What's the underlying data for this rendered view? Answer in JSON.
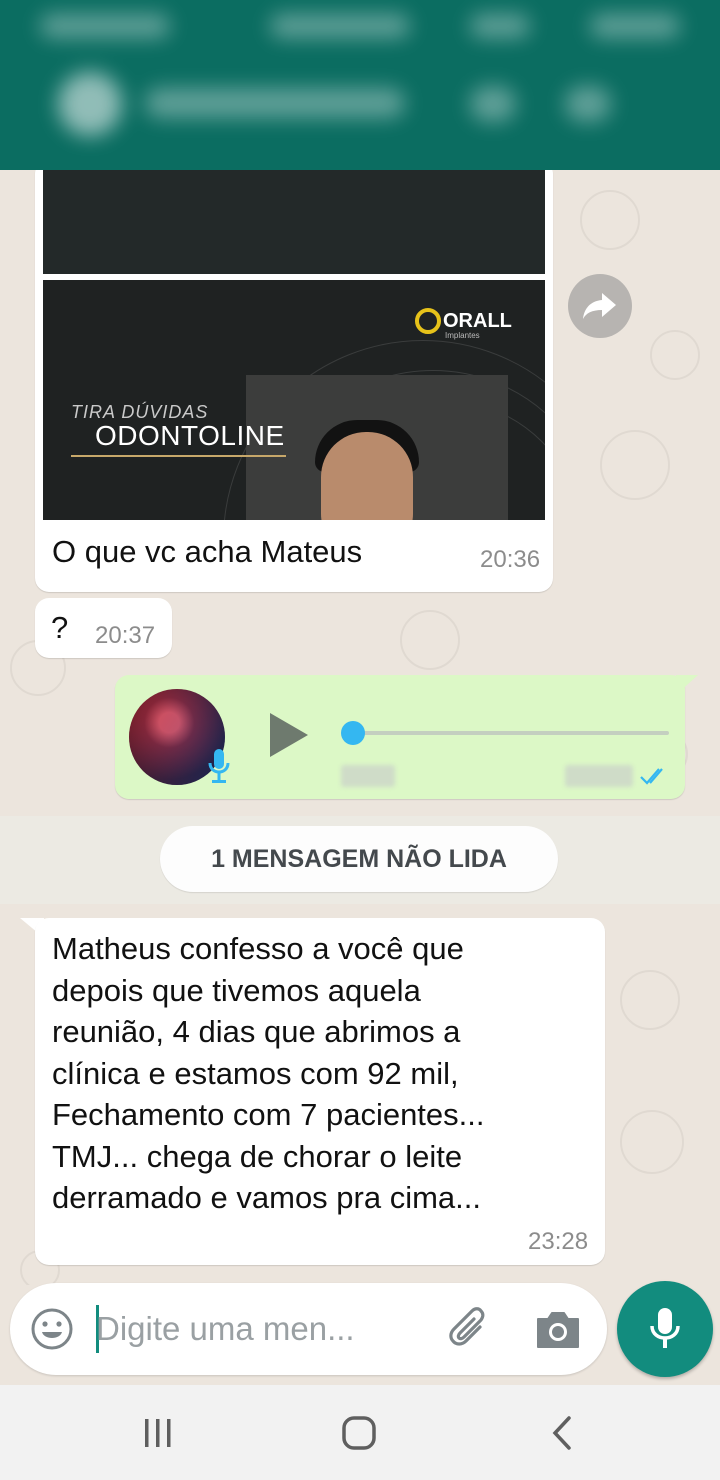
{
  "header": {
    "contact_name": "",
    "blurred": true
  },
  "messages": {
    "video_card": {
      "brand_logo": "ORALL",
      "brand_sub": "Implantes",
      "title_small": "TIRA DÚVIDAS",
      "title_big": "ODONTOLINE",
      "caption": "O que vc acha Mateus",
      "time": "20:36"
    },
    "question": {
      "text": "?",
      "time": "20:37"
    },
    "voice_note": {
      "progress": 0.0,
      "status": "read",
      "accent_color": "#34b7f1"
    },
    "unread_divider": "1 MENSAGEM NÃO LIDA",
    "long_message": {
      "text": "Matheus confesso a você que\ndepois que tivemos aquela\nreunião, 4 dias que abrimos a\nclínica e estamos com 92 mil,\nFechamento com 7 pacientes...\nTMJ... chega de chorar o leite\nderramado e vamos pra cima...",
      "time": "23:28"
    }
  },
  "composer": {
    "placeholder": "Digite uma men...",
    "emoji_icon": "emoji-icon",
    "attach_icon": "paperclip-icon",
    "camera_icon": "camera-icon",
    "mic_icon": "microphone-icon"
  },
  "colors": {
    "header": "#0b6d61",
    "outgoing_bubble": "#dcf8c6",
    "incoming_bubble": "#ffffff",
    "chat_background": "#ece5dd",
    "mic_button": "#128c7e"
  },
  "navigation": {
    "recent_icon": "recent-apps-icon",
    "home_icon": "home-icon",
    "back_icon": "back-icon"
  }
}
